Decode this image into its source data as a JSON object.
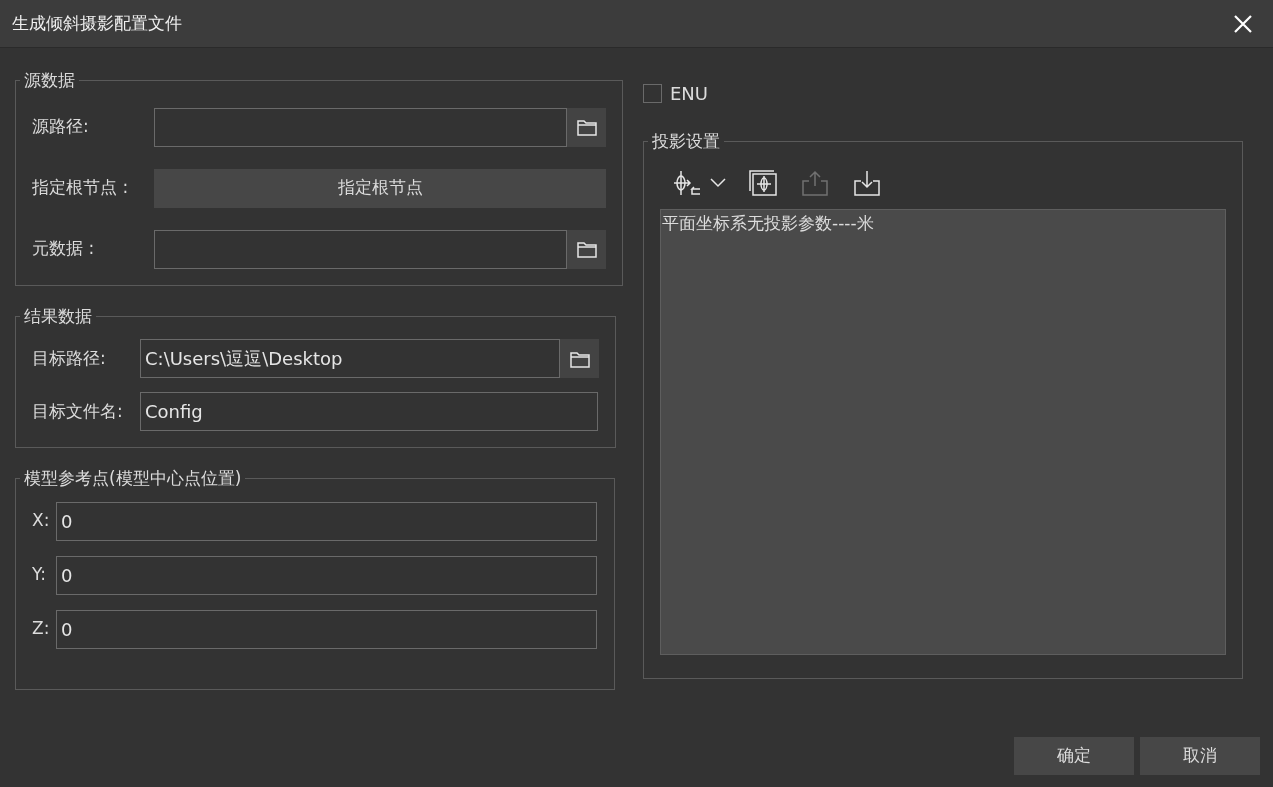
{
  "window": {
    "title": "生成倾斜摄影配置文件"
  },
  "source_group": {
    "title": "源数据",
    "rows": [
      {
        "kind": "path",
        "label": "源路径:",
        "value": ""
      },
      {
        "kind": "button",
        "label": "指定根节点 :",
        "button": "指定根节点"
      },
      {
        "kind": "path",
        "label": "元数据 :",
        "value": ""
      }
    ]
  },
  "result_group": {
    "title": "结果数据",
    "rows": [
      {
        "kind": "path",
        "label": "目标路径:",
        "value": "C:\\Users\\逗逗\\Desktop"
      },
      {
        "kind": "text",
        "label": "目标文件名:",
        "value": "Config"
      }
    ]
  },
  "reference_group": {
    "title": "模型参考点(模型中心点位置)",
    "rows": [
      {
        "label": "X:",
        "value": "0"
      },
      {
        "label": "Y:",
        "value": "0"
      },
      {
        "label": "Z:",
        "value": "0"
      }
    ]
  },
  "enu": {
    "label": "ENU",
    "checked": false
  },
  "projection_group": {
    "title": "投影设置",
    "toolbar": [
      {
        "kind": "coord",
        "disabled": false
      },
      {
        "kind": "frame",
        "disabled": false
      },
      {
        "kind": "export",
        "disabled": true
      },
      {
        "kind": "import",
        "disabled": false
      }
    ],
    "text": "平面坐标系无投影参数----米"
  },
  "buttons": [
    {
      "label": "确定"
    },
    {
      "label": "取消"
    }
  ]
}
